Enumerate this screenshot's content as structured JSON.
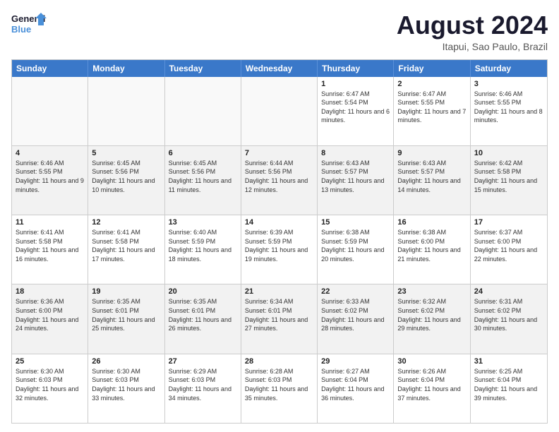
{
  "logo": {
    "text_general": "General",
    "text_blue": "Blue"
  },
  "title": "August 2024",
  "subtitle": "Itapui, Sao Paulo, Brazil",
  "header_days": [
    "Sunday",
    "Monday",
    "Tuesday",
    "Wednesday",
    "Thursday",
    "Friday",
    "Saturday"
  ],
  "weeks": [
    [
      {
        "day": "",
        "sunrise": "",
        "sunset": "",
        "daylight": "",
        "empty": true
      },
      {
        "day": "",
        "sunrise": "",
        "sunset": "",
        "daylight": "",
        "empty": true
      },
      {
        "day": "",
        "sunrise": "",
        "sunset": "",
        "daylight": "",
        "empty": true
      },
      {
        "day": "",
        "sunrise": "",
        "sunset": "",
        "daylight": "",
        "empty": true
      },
      {
        "day": "1",
        "sunrise": "Sunrise: 6:47 AM",
        "sunset": "Sunset: 5:54 PM",
        "daylight": "Daylight: 11 hours and 6 minutes."
      },
      {
        "day": "2",
        "sunrise": "Sunrise: 6:47 AM",
        "sunset": "Sunset: 5:55 PM",
        "daylight": "Daylight: 11 hours and 7 minutes."
      },
      {
        "day": "3",
        "sunrise": "Sunrise: 6:46 AM",
        "sunset": "Sunset: 5:55 PM",
        "daylight": "Daylight: 11 hours and 8 minutes."
      }
    ],
    [
      {
        "day": "4",
        "sunrise": "Sunrise: 6:46 AM",
        "sunset": "Sunset: 5:55 PM",
        "daylight": "Daylight: 11 hours and 9 minutes."
      },
      {
        "day": "5",
        "sunrise": "Sunrise: 6:45 AM",
        "sunset": "Sunset: 5:56 PM",
        "daylight": "Daylight: 11 hours and 10 minutes."
      },
      {
        "day": "6",
        "sunrise": "Sunrise: 6:45 AM",
        "sunset": "Sunset: 5:56 PM",
        "daylight": "Daylight: 11 hours and 11 minutes."
      },
      {
        "day": "7",
        "sunrise": "Sunrise: 6:44 AM",
        "sunset": "Sunset: 5:56 PM",
        "daylight": "Daylight: 11 hours and 12 minutes."
      },
      {
        "day": "8",
        "sunrise": "Sunrise: 6:43 AM",
        "sunset": "Sunset: 5:57 PM",
        "daylight": "Daylight: 11 hours and 13 minutes."
      },
      {
        "day": "9",
        "sunrise": "Sunrise: 6:43 AM",
        "sunset": "Sunset: 5:57 PM",
        "daylight": "Daylight: 11 hours and 14 minutes."
      },
      {
        "day": "10",
        "sunrise": "Sunrise: 6:42 AM",
        "sunset": "Sunset: 5:58 PM",
        "daylight": "Daylight: 11 hours and 15 minutes."
      }
    ],
    [
      {
        "day": "11",
        "sunrise": "Sunrise: 6:41 AM",
        "sunset": "Sunset: 5:58 PM",
        "daylight": "Daylight: 11 hours and 16 minutes."
      },
      {
        "day": "12",
        "sunrise": "Sunrise: 6:41 AM",
        "sunset": "Sunset: 5:58 PM",
        "daylight": "Daylight: 11 hours and 17 minutes."
      },
      {
        "day": "13",
        "sunrise": "Sunrise: 6:40 AM",
        "sunset": "Sunset: 5:59 PM",
        "daylight": "Daylight: 11 hours and 18 minutes."
      },
      {
        "day": "14",
        "sunrise": "Sunrise: 6:39 AM",
        "sunset": "Sunset: 5:59 PM",
        "daylight": "Daylight: 11 hours and 19 minutes."
      },
      {
        "day": "15",
        "sunrise": "Sunrise: 6:38 AM",
        "sunset": "Sunset: 5:59 PM",
        "daylight": "Daylight: 11 hours and 20 minutes."
      },
      {
        "day": "16",
        "sunrise": "Sunrise: 6:38 AM",
        "sunset": "Sunset: 6:00 PM",
        "daylight": "Daylight: 11 hours and 21 minutes."
      },
      {
        "day": "17",
        "sunrise": "Sunrise: 6:37 AM",
        "sunset": "Sunset: 6:00 PM",
        "daylight": "Daylight: 11 hours and 22 minutes."
      }
    ],
    [
      {
        "day": "18",
        "sunrise": "Sunrise: 6:36 AM",
        "sunset": "Sunset: 6:00 PM",
        "daylight": "Daylight: 11 hours and 24 minutes."
      },
      {
        "day": "19",
        "sunrise": "Sunrise: 6:35 AM",
        "sunset": "Sunset: 6:01 PM",
        "daylight": "Daylight: 11 hours and 25 minutes."
      },
      {
        "day": "20",
        "sunrise": "Sunrise: 6:35 AM",
        "sunset": "Sunset: 6:01 PM",
        "daylight": "Daylight: 11 hours and 26 minutes."
      },
      {
        "day": "21",
        "sunrise": "Sunrise: 6:34 AM",
        "sunset": "Sunset: 6:01 PM",
        "daylight": "Daylight: 11 hours and 27 minutes."
      },
      {
        "day": "22",
        "sunrise": "Sunrise: 6:33 AM",
        "sunset": "Sunset: 6:02 PM",
        "daylight": "Daylight: 11 hours and 28 minutes."
      },
      {
        "day": "23",
        "sunrise": "Sunrise: 6:32 AM",
        "sunset": "Sunset: 6:02 PM",
        "daylight": "Daylight: 11 hours and 29 minutes."
      },
      {
        "day": "24",
        "sunrise": "Sunrise: 6:31 AM",
        "sunset": "Sunset: 6:02 PM",
        "daylight": "Daylight: 11 hours and 30 minutes."
      }
    ],
    [
      {
        "day": "25",
        "sunrise": "Sunrise: 6:30 AM",
        "sunset": "Sunset: 6:03 PM",
        "daylight": "Daylight: 11 hours and 32 minutes."
      },
      {
        "day": "26",
        "sunrise": "Sunrise: 6:30 AM",
        "sunset": "Sunset: 6:03 PM",
        "daylight": "Daylight: 11 hours and 33 minutes."
      },
      {
        "day": "27",
        "sunrise": "Sunrise: 6:29 AM",
        "sunset": "Sunset: 6:03 PM",
        "daylight": "Daylight: 11 hours and 34 minutes."
      },
      {
        "day": "28",
        "sunrise": "Sunrise: 6:28 AM",
        "sunset": "Sunset: 6:03 PM",
        "daylight": "Daylight: 11 hours and 35 minutes."
      },
      {
        "day": "29",
        "sunrise": "Sunrise: 6:27 AM",
        "sunset": "Sunset: 6:04 PM",
        "daylight": "Daylight: 11 hours and 36 minutes."
      },
      {
        "day": "30",
        "sunrise": "Sunrise: 6:26 AM",
        "sunset": "Sunset: 6:04 PM",
        "daylight": "Daylight: 11 hours and 37 minutes."
      },
      {
        "day": "31",
        "sunrise": "Sunrise: 6:25 AM",
        "sunset": "Sunset: 6:04 PM",
        "daylight": "Daylight: 11 hours and 39 minutes."
      }
    ]
  ]
}
